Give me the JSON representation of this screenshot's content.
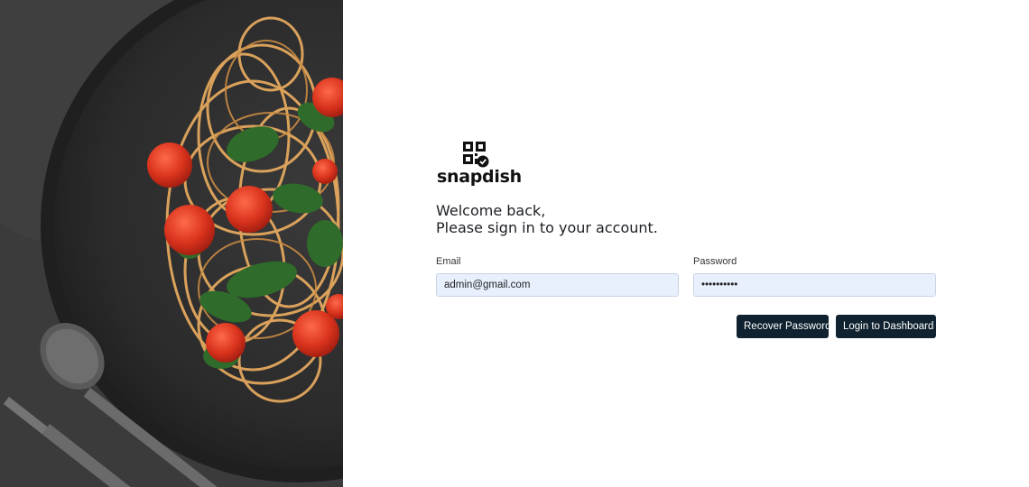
{
  "brand": {
    "name": "snapdish",
    "logo_icon": "qr-check-icon"
  },
  "hero": {
    "image": "pasta-plate-photo",
    "colors": {
      "plate": "#2e2e2e",
      "pasta": "#e0a25a",
      "tomato": "#d83a22",
      "spinach": "#2f6b2a"
    }
  },
  "welcome": {
    "line1": "Welcome back,",
    "line2": "Please sign in to your account."
  },
  "form": {
    "email": {
      "label": "Email",
      "value": "admin@gmail.com"
    },
    "password": {
      "label": "Password",
      "value": "••••••••••"
    }
  },
  "actions": {
    "recover_label": "Recover Password",
    "login_label": "Login to Dashboard"
  },
  "colors": {
    "button_bg": "#10222f",
    "input_bg": "#e8f0fe"
  }
}
